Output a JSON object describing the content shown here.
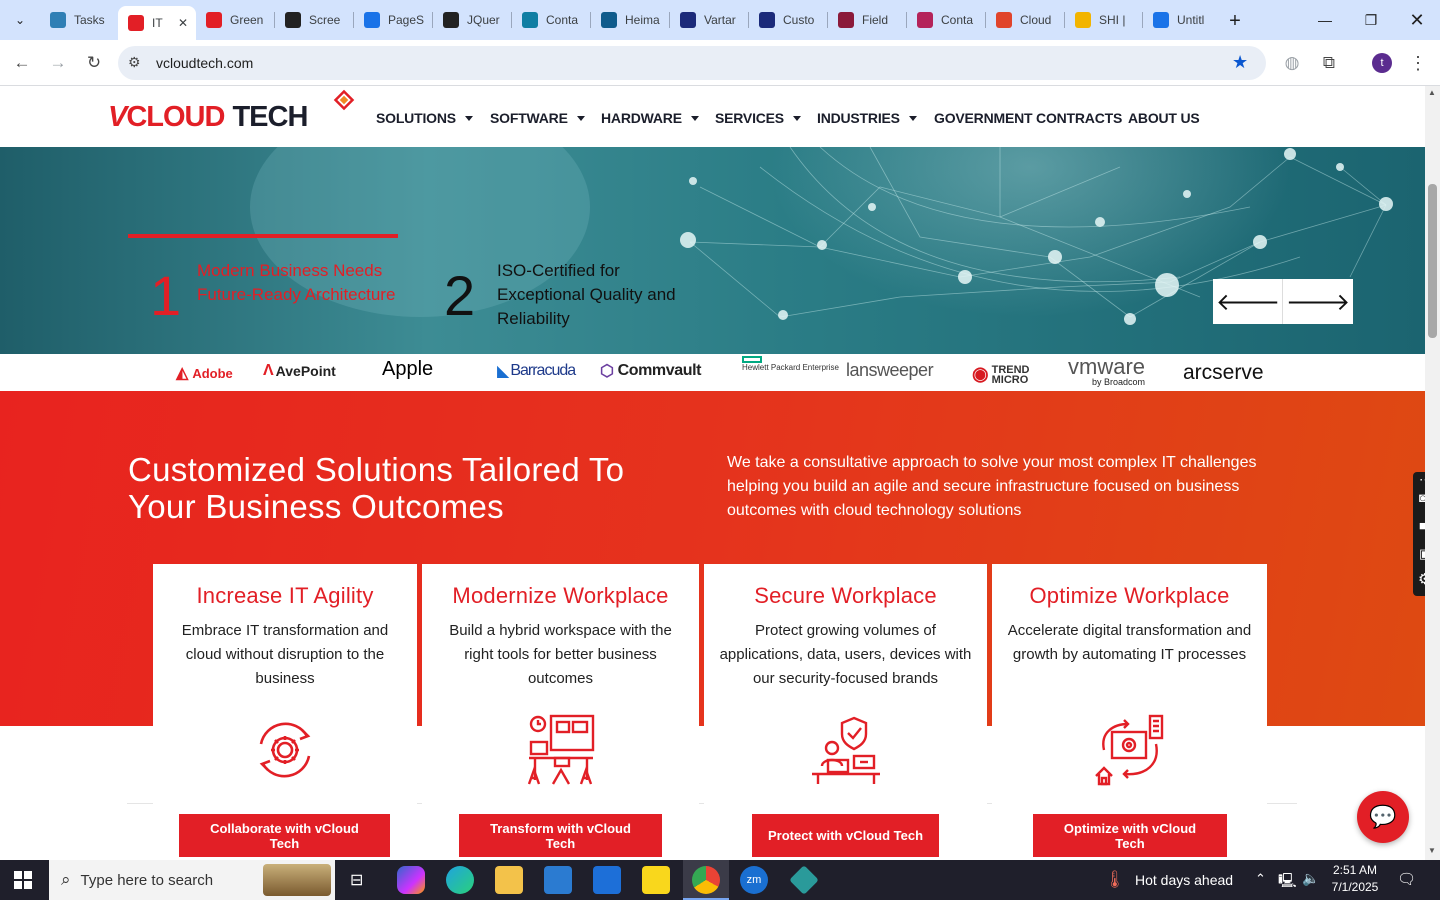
{
  "browser": {
    "tabs": [
      {
        "label": "Tasks",
        "color": "#2f7fb5",
        "icon": "circle-icon"
      },
      {
        "label": "IT",
        "color": "#e21f26",
        "icon": "vcloud-icon"
      },
      {
        "label": "Green",
        "color": "#e21f26",
        "icon": "vcloud-icon"
      },
      {
        "label": "Scree",
        "color": "#222222",
        "icon": "gear-icon"
      },
      {
        "label": "PageS",
        "color": "#1a73e8",
        "icon": "gauge-icon"
      },
      {
        "label": "JQuer",
        "color": "#222222",
        "icon": "openai-icon"
      },
      {
        "label": "Conta",
        "color": "#0f7ea3",
        "icon": "diamond-icon"
      },
      {
        "label": "Heima",
        "color": "#0f5b8c",
        "icon": "tree-icon"
      },
      {
        "label": "Vartar",
        "color": "#1b2a7a",
        "icon": "x-icon"
      },
      {
        "label": "Custo",
        "color": "#1b2a7a",
        "icon": "check-icon"
      },
      {
        "label": "Field",
        "color": "#8b1a3a",
        "icon": "v-icon"
      },
      {
        "label": "Conta",
        "color": "#b4235a",
        "icon": "contact-icon"
      },
      {
        "label": "Cloud",
        "color": "#e0442b",
        "icon": "cloud-icon"
      },
      {
        "label": "SHI |",
        "color": "#f2b400",
        "icon": "ring-icon"
      },
      {
        "label": "Untitl",
        "color": "#1a73e8",
        "icon": "doc-icon"
      }
    ],
    "url": "vcloudtech.com",
    "profile_initial": "t"
  },
  "site": {
    "logo_text": "VCLOUD TECH",
    "nav": [
      {
        "label": "SOLUTIONS",
        "dropdown": true
      },
      {
        "label": "SOFTWARE",
        "dropdown": true
      },
      {
        "label": "HARDWARE",
        "dropdown": true
      },
      {
        "label": "SERVICES",
        "dropdown": true
      },
      {
        "label": "INDUSTRIES",
        "dropdown": true
      },
      {
        "label": "GOVERNMENT CONTRACTS",
        "dropdown": false
      },
      {
        "label": "ABOUT US",
        "dropdown": false
      }
    ],
    "hero": {
      "slide1_number": "1",
      "slide1_text": "Modern Business Needs Future-Ready Architecture",
      "slide2_number": "2",
      "slide2_text": "ISO-Certified for Exceptional Quality and Reliability",
      "prev_arrow": "🡐",
      "next_arrow": "🡒"
    },
    "partner_logos": [
      "Adobe",
      "AvePoint",
      "Apple",
      "Barracuda",
      "Commvault",
      "Hewlett Packard Enterprise",
      "lansweeper",
      "TREND MICRO",
      "vmware",
      "by Broadcom",
      "arcserve"
    ],
    "section": {
      "title_line1": "Customized Solutions Tailored To",
      "title_line2": "Your Business Outcomes",
      "description": "We take a consultative approach to solve your most complex IT challenges helping you build an agile and secure infrastructure focused on business outcomes with cloud technology solutions"
    },
    "cards": [
      {
        "title": "Increase IT Agility",
        "text": "Embrace IT transformation and cloud without disruption to the business",
        "button": "Collaborate with vCloud Tech",
        "icon": "gear-cycle-icon"
      },
      {
        "title": "Modernize Workplace",
        "text": "Build a hybrid workspace with the right tools for better business outcomes",
        "button": "Transform with vCloud Tech",
        "icon": "hybrid-workspace-icon"
      },
      {
        "title": "Secure Workplace",
        "text": "Protect growing volumes of applications, data, users, devices with our security-focused brands",
        "button": "Protect with vCloud Tech",
        "icon": "secure-worker-icon"
      },
      {
        "title": "Optimize Workplace",
        "text": "Accelerate digital transformation and growth by automating IT processes",
        "button": "Optimize with vCloud Tech",
        "icon": "automation-icon"
      }
    ]
  },
  "taskbar": {
    "search_placeholder": "Type here to search",
    "weather": "Hot days ahead",
    "time": "2:51 AM",
    "date": "7/1/2025"
  },
  "colors": {
    "brand_red": "#e21f26",
    "tab_strip": "#d3e3fd",
    "hero_teal": "#2b7d86"
  }
}
